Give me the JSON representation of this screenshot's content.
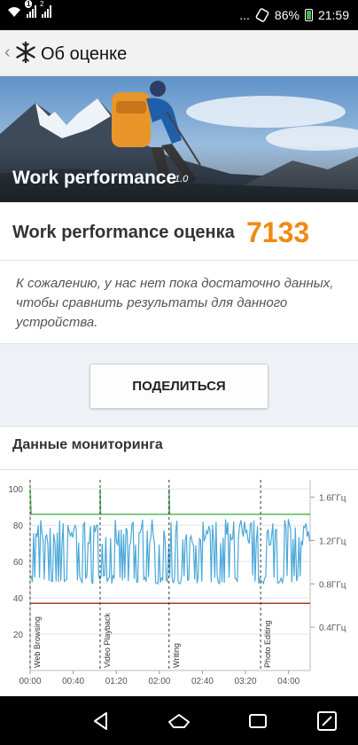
{
  "status_bar": {
    "sim1_badge": "1",
    "sim2_badge": "2",
    "overflow": "...",
    "battery_percent": "86%",
    "time": "21:59"
  },
  "app_bar": {
    "title": "Об оценке"
  },
  "hero": {
    "title": "Work performance",
    "version": "1.0"
  },
  "score": {
    "label": "Work performance оценка",
    "value": "7133",
    "value_color": "#f08a12"
  },
  "note": {
    "text": "К сожалению, у нас нет пока достаточно данных, чтобы сравнить результаты для данного устройства."
  },
  "share_button": {
    "label": "ПОДЕЛИТЬСЯ"
  },
  "monitoring": {
    "title": "Данные мониторинга"
  },
  "chart_data": {
    "type": "line",
    "title": "",
    "x_ticks": [
      "00:00",
      "00:40",
      "01:20",
      "02:00",
      "02:40",
      "03:20",
      "04:00"
    ],
    "x_range_seconds": [
      0,
      260
    ],
    "y_left_ticks": [
      20,
      40,
      60,
      80,
      100
    ],
    "y_left_range": [
      0,
      105
    ],
    "y_right_ticks": [
      "0.4ГГц",
      "0.8ГГц",
      "1.2ГГц",
      "1.6ГГц"
    ],
    "y_right_range_ghz": [
      0,
      1.76
    ],
    "grid": true,
    "phase_markers": [
      {
        "label": "Web Browsing",
        "t": 0
      },
      {
        "label": "Video Playback",
        "t": 65
      },
      {
        "label": "Writing",
        "t": 129
      },
      {
        "label": "Photo Editing",
        "t": 214
      }
    ],
    "series": [
      {
        "key": "battery",
        "color": "#5cb85c",
        "values_level": 86,
        "spike_to": 100
      },
      {
        "key": "temperature",
        "color": "#a0412c",
        "values_level": 37
      },
      {
        "key": "cpu_freq",
        "color": "#4aa8d8",
        "values_range_ghz": [
          0.8,
          1.4
        ]
      }
    ]
  },
  "nav_bar": {
    "back": "back-icon",
    "home": "home-icon",
    "recents": "recents-icon",
    "edit": "edit-icon"
  }
}
